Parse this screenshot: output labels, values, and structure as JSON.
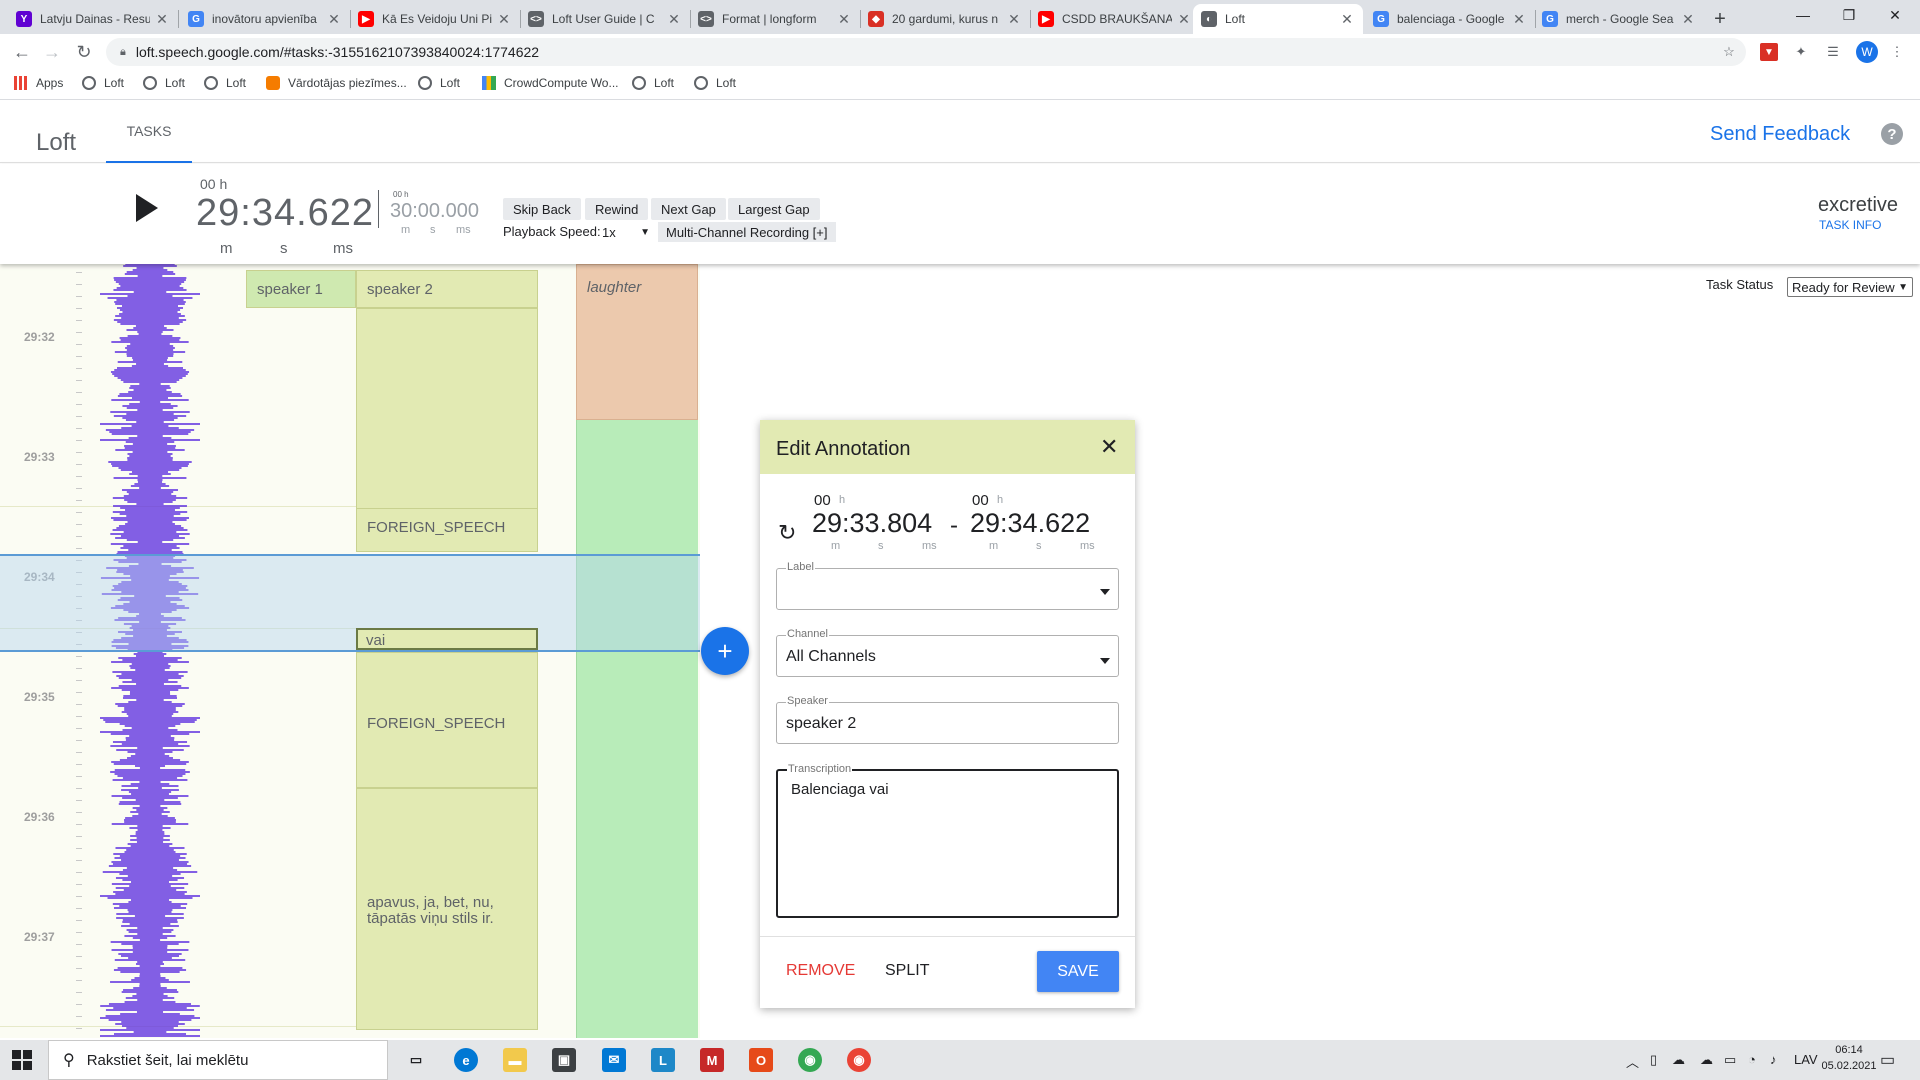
{
  "browser": {
    "tabs": [
      {
        "title": "Latvju Dainas - Resu",
        "icon": "yahoo-icon",
        "color": "#6001d2",
        "glyph": "Y"
      },
      {
        "title": "inovātoru apvienība",
        "icon": "google-icon",
        "color": "#4285f4",
        "glyph": "G"
      },
      {
        "title": "Kā Es Veidoju Uni Pi",
        "icon": "youtube-icon",
        "color": "#ff0000",
        "glyph": "▶"
      },
      {
        "title": "Loft User Guide | C",
        "icon": "code-icon",
        "color": "#5f6368",
        "glyph": "<>"
      },
      {
        "title": "Format | longform",
        "icon": "code-icon",
        "color": "#5f6368",
        "glyph": "<>"
      },
      {
        "title": "20 gardumi, kurus n",
        "icon": "diamond-icon",
        "color": "#d93025",
        "glyph": "◆"
      },
      {
        "title": "CSDD BRAUKŠANA",
        "icon": "youtube-icon",
        "color": "#ff0000",
        "glyph": "▶"
      },
      {
        "title": "Loft",
        "icon": "loft-icon",
        "color": "#5f6368",
        "glyph": "◐"
      },
      {
        "title": "balenciaga - Google",
        "icon": "google-icon",
        "color": "#4285f4",
        "glyph": "G"
      },
      {
        "title": "merch - Google Sea",
        "icon": "google-icon",
        "color": "#4285f4",
        "glyph": "G"
      }
    ],
    "active_tab": 7,
    "new_tab": "+",
    "url": "loft.speech.google.com/#tasks:-3155162107393840024:1774622",
    "bookmarks": [
      {
        "label": "Apps",
        "icon": "apps-icon"
      },
      {
        "label": "Loft",
        "icon": "loft-icon"
      },
      {
        "label": "Loft",
        "icon": "loft-icon"
      },
      {
        "label": "Loft",
        "icon": "loft-icon"
      },
      {
        "label": "Vārdotājas piezīmes...",
        "icon": "blogger-icon"
      },
      {
        "label": "Loft",
        "icon": "loft-icon"
      },
      {
        "label": "CrowdCompute Wo...",
        "icon": "crowdcompute-icon"
      },
      {
        "label": "Loft",
        "icon": "loft-icon"
      },
      {
        "label": "Loft",
        "icon": "loft-icon"
      }
    ],
    "profile_initial": "W"
  },
  "app": {
    "logo": "Loft",
    "tab_tasks": "TASKS",
    "feedback": "Send Feedback",
    "help": "?"
  },
  "player": {
    "hours_label": "00 h",
    "current_time": "29:34.622",
    "unit_m": "m",
    "unit_s": "s",
    "unit_ms": "ms",
    "total_hours": "00 h",
    "total_time": "30:00.000",
    "buttons": [
      "Skip Back",
      "Rewind",
      "Next Gap",
      "Largest Gap"
    ],
    "speed_label": "Playback Speed:",
    "speed_value": "1x",
    "multichannel": "Multi-Channel Recording [+]",
    "task_name": "excretive",
    "task_info": "TASK INFO"
  },
  "timeline": {
    "time_labels": [
      "29:32",
      "29:33",
      "29:34",
      "29:35",
      "29:36",
      "29:37"
    ],
    "speaker1": "speaker 1",
    "speaker2": "speaker 2",
    "laughter": "laughter",
    "segments": [
      "FOREIGN_SPEECH",
      "vai",
      "FOREIGN_SPEECH",
      "apavus, ja, bet, nu, tāpatās viņu stils ir."
    ],
    "add": "+"
  },
  "task_status": {
    "label": "Task Status",
    "value": "Ready for Review"
  },
  "dialog": {
    "title": "Edit Annotation",
    "close": "✕",
    "start_hours": "00",
    "end_hours": "00",
    "h": "h",
    "start_time": "29:33.804",
    "end_time": "29:34.622",
    "dash": "-",
    "label_label": "Label",
    "label_value": "",
    "channel_label": "Channel",
    "channel_value": "All Channels",
    "speaker_label": "Speaker",
    "speaker_value": "speaker 2",
    "transcription_label": "Transcription",
    "transcription_value": "Balenciaga vai",
    "remove": "REMOVE",
    "split": "SPLIT",
    "save": "SAVE"
  },
  "taskbar": {
    "search_placeholder": "Rakstiet šeit, lai meklētu",
    "lang": "LAV",
    "time": "06:14",
    "date": "05.02.2021"
  }
}
